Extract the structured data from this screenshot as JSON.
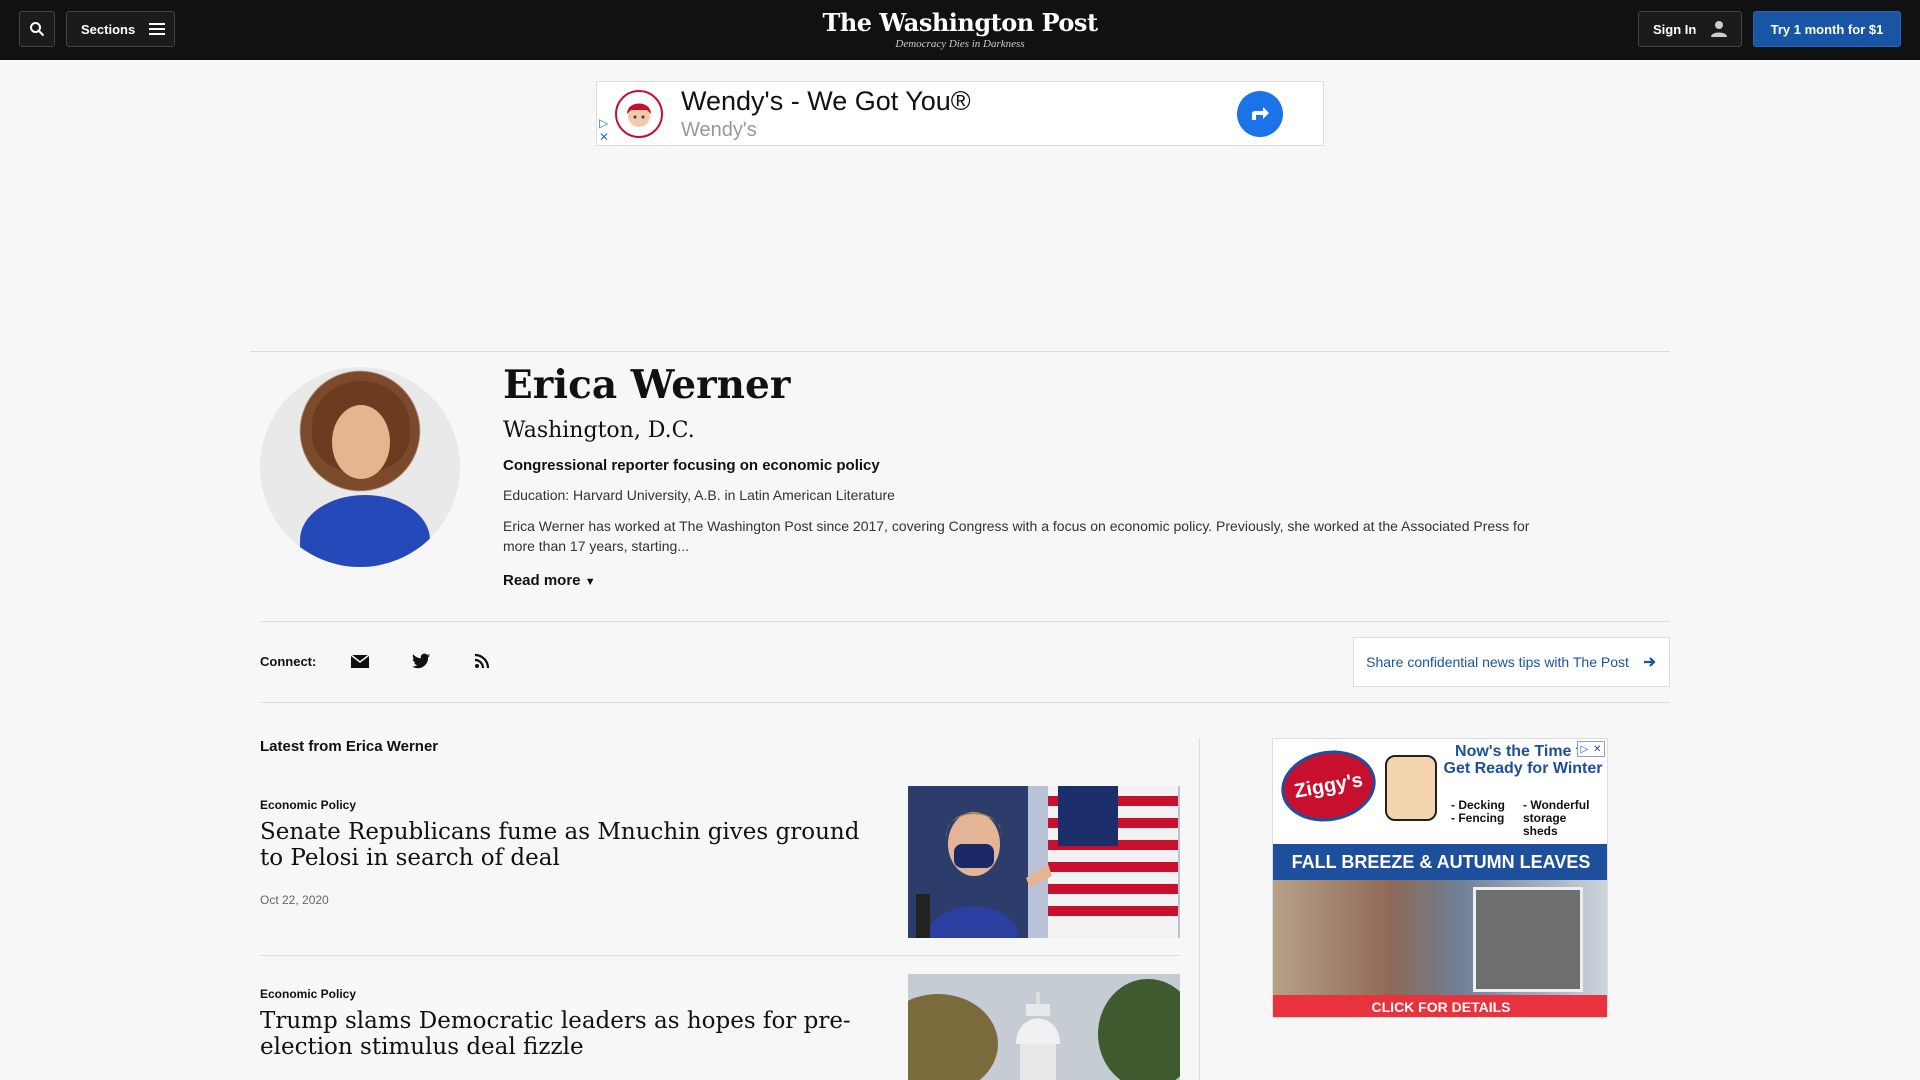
{
  "header": {
    "search_icon": "search-icon",
    "sections_label": "Sections",
    "brand_title": "The Washington Post",
    "brand_tagline": "Democracy Dies in Darkness",
    "sign_in_label": "Sign In",
    "try_label": "Try 1 month for $1"
  },
  "top_ad": {
    "title": "Wendy's - We Got You®",
    "advertiser": "Wendy's"
  },
  "author": {
    "name": "Erica Werner",
    "location": "Washington, D.C.",
    "role": "Congressional reporter focusing on economic policy",
    "education": "Education: Harvard University, A.B. in Latin American Literature",
    "bio": "Erica Werner has worked at The Washington Post since 2017, covering Congress with a focus on economic policy. Previously, she worked at the Associated Press for more than 17 years, starting...",
    "read_more": "Read more"
  },
  "connect": {
    "label": "Connect:",
    "icons": [
      "email-icon",
      "twitter-icon",
      "rss-icon"
    ],
    "tips_label": "Share confidential news tips with The Post"
  },
  "latest": {
    "heading": "Latest from Erica Werner",
    "stories": [
      {
        "kicker": "Economic Policy",
        "headline": "Senate Republicans fume as Mnuchin gives ground to Pelosi in search of deal",
        "date": "Oct 22, 2020"
      },
      {
        "kicker": "Economic Policy",
        "headline": "Trump slams Democratic leaders as hopes for pre-election stimulus deal fizzle"
      }
    ]
  },
  "side_ad": {
    "brand": "Ziggy's",
    "headline": "Now's the Time to Get Ready for Winter",
    "list_a": "- Decking - Fencing",
    "list_b": "- Wonderful storage sheds",
    "banner": "FALL BREEZE & AUTUMN LEAVES",
    "cta": "CLICK FOR DETAILS"
  },
  "colors": {
    "accent": "#1955a5",
    "topbar": "#111111"
  }
}
